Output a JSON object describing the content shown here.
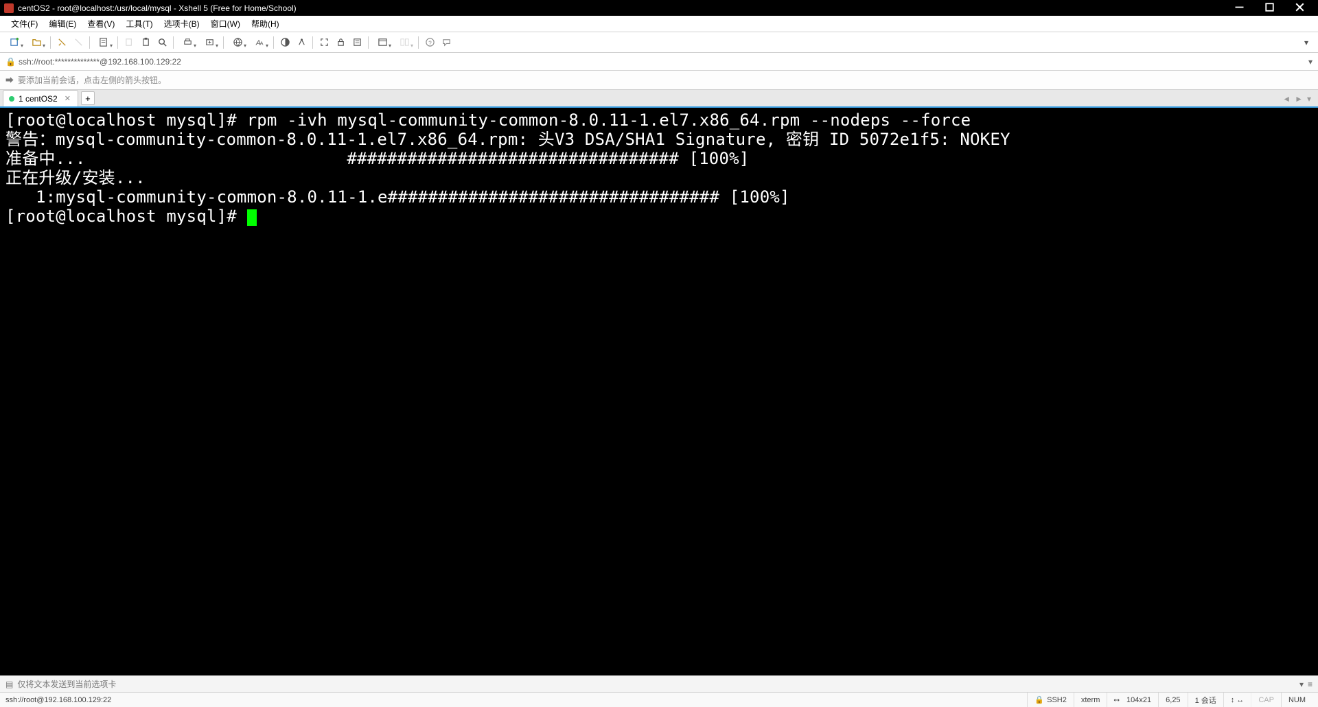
{
  "window": {
    "title": "centOS2 - root@localhost:/usr/local/mysql - Xshell 5 (Free for Home/School)"
  },
  "menu": {
    "items": [
      "文件(F)",
      "编辑(E)",
      "查看(V)",
      "工具(T)",
      "选项卡(B)",
      "窗口(W)",
      "帮助(H)"
    ]
  },
  "address": {
    "text": "ssh://root:**************@192.168.100.129:22"
  },
  "hint": {
    "text": "要添加当前会话，点击左侧的箭头按钮。"
  },
  "tabs": {
    "items": [
      {
        "label": "1 centOS2",
        "active": true
      }
    ]
  },
  "terminal": {
    "lines": [
      "[root@localhost mysql]# rpm -ivh mysql-community-common-8.0.11-1.el7.x86_64.rpm --nodeps --force",
      "警告：mysql-community-common-8.0.11-1.el7.x86_64.rpm: 头V3 DSA/SHA1 Signature, 密钥 ID 5072e1f5: NOKEY",
      "准备中...                          ################################# [100%]",
      "正在升级/安装...",
      "   1:mysql-community-common-8.0.11-1.e################################# [100%]",
      "[root@localhost mysql]# "
    ]
  },
  "compose": {
    "text": "仅将文本发送到当前选项卡"
  },
  "status": {
    "left": "ssh://root@192.168.100.129:22",
    "ssh": "SSH2",
    "term": "xterm",
    "size": "104x21",
    "pos": "6,25",
    "session": "1 会话",
    "cap": "CAP",
    "num": "NUM"
  }
}
